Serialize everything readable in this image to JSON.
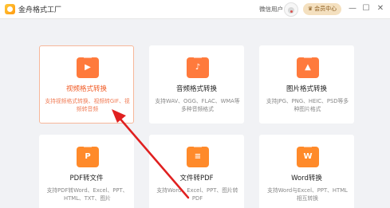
{
  "app": {
    "title": "金舟格式工厂"
  },
  "header": {
    "user_label": "微信用户",
    "vip_label": "会员中心",
    "minimize": "—",
    "maximize": "☐",
    "close": "✕"
  },
  "cards": [
    {
      "title": "视频格式转换",
      "desc": "支持视频格式转换、视频转GIF、视频转音频",
      "icon": "video-convert-icon",
      "glyph": "▶",
      "color": "#ff7a3c",
      "active": true
    },
    {
      "title": "音频格式转换",
      "desc": "支持WAV、OGG、FLAC、WMA等多种音频格式",
      "icon": "audio-convert-icon",
      "glyph": "♪",
      "color": "#ff7a3c",
      "active": false
    },
    {
      "title": "图片格式转换",
      "desc": "支持JPG、PNG、HEIC、PSD等多种图片格式",
      "icon": "image-convert-icon",
      "glyph": "▲",
      "color": "#ff7a3c",
      "active": false
    },
    {
      "title": "PDF转文件",
      "desc": "支持PDF转Word、Excel、PPT、HTML、TXT、图片",
      "icon": "pdf-convert-icon",
      "glyph": "P",
      "color": "#ff8a2a",
      "active": false
    },
    {
      "title": "文件转PDF",
      "desc": "支持Word、Excel、PPT、图片转PDF",
      "icon": "file-to-pdf-icon",
      "glyph": "≡",
      "color": "#ff8a2a",
      "active": false
    },
    {
      "title": "Word转换",
      "desc": "支持Word与Excel、PPT、HTML相互转换",
      "icon": "word-convert-icon",
      "glyph": "W",
      "color": "#ff8a2a",
      "active": false
    }
  ]
}
